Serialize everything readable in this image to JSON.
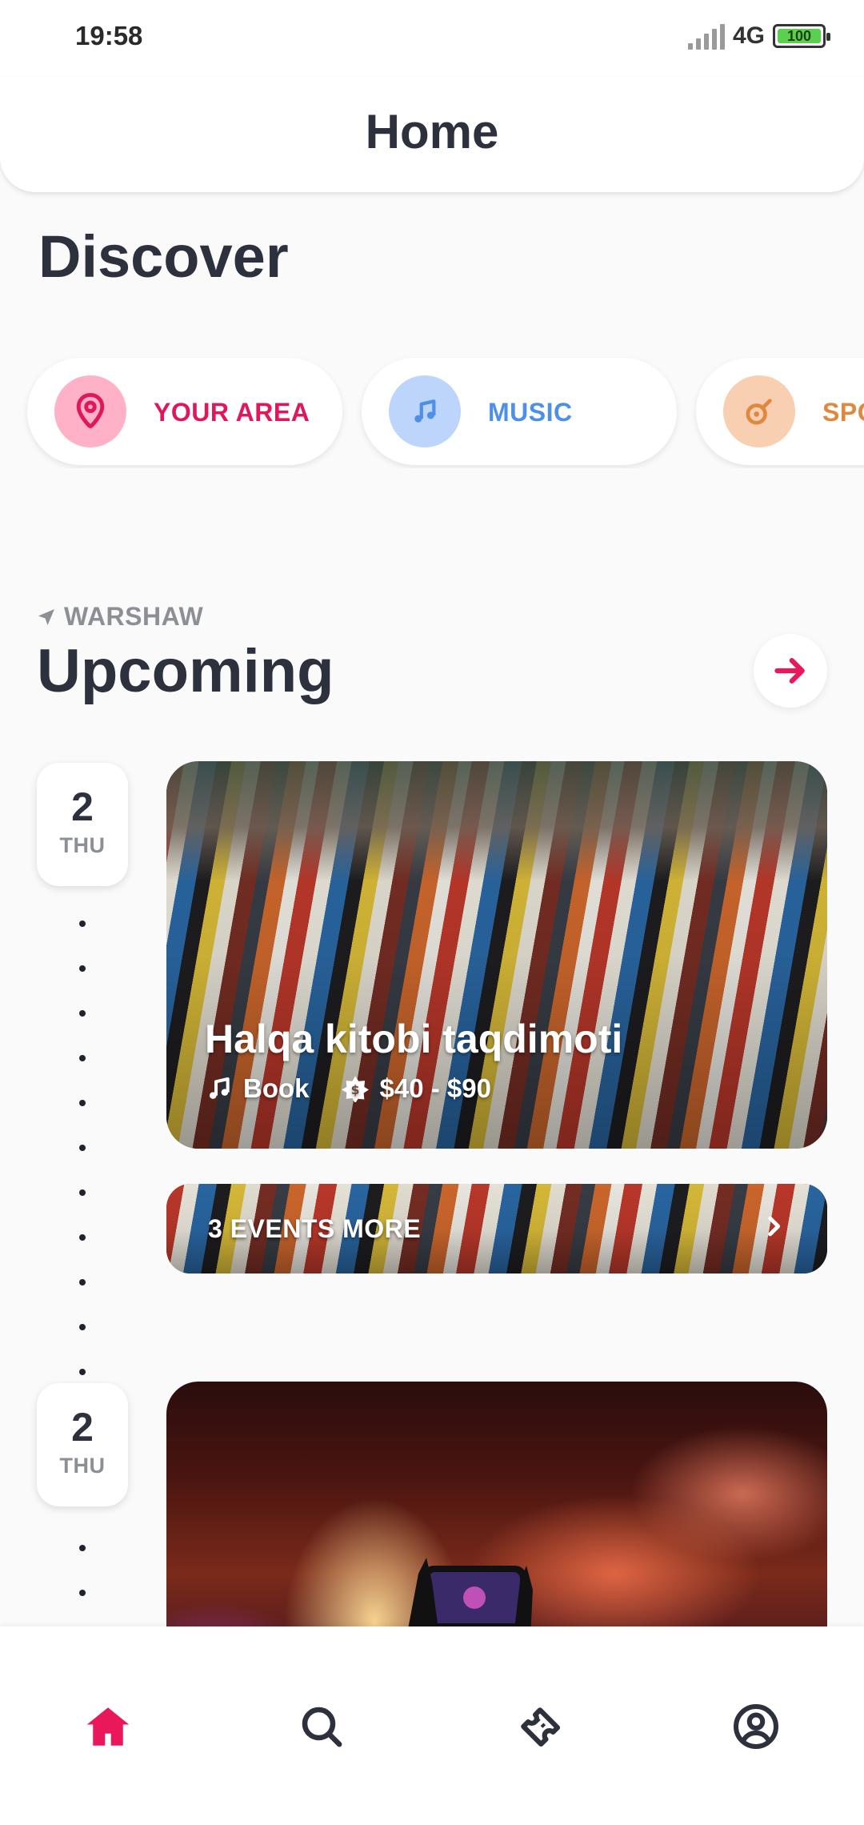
{
  "status_bar": {
    "time": "19:58",
    "network": "4G",
    "battery": "100"
  },
  "header": {
    "title": "Home"
  },
  "discover": {
    "title": "Discover"
  },
  "categories": [
    {
      "label": "YOUR AREA",
      "icon": "location-pin-icon",
      "color": "#e0185a",
      "bg": "#ffb1c8"
    },
    {
      "label": "MUSIC",
      "icon": "music-note-icon",
      "color": "#4e8fe8",
      "bg": "#bdd5fb"
    },
    {
      "label": "SPORTS",
      "icon": "sport-icon",
      "color": "#e0893e",
      "bg": "#f8cfb1"
    }
  ],
  "upcoming": {
    "location": "WARSHAW",
    "title": "Upcoming",
    "accent": "#e8185a",
    "groups": [
      {
        "date": {
          "day_number": "2",
          "weekday": "THU"
        },
        "event": {
          "title": "Halqa kitobi taqdimoti",
          "category": "Book",
          "price": "$40 - $90"
        },
        "more_label": "3 EVENTS MORE"
      },
      {
        "date": {
          "day_number": "2",
          "weekday": "THU"
        }
      }
    ]
  },
  "bottom_nav": [
    {
      "icon": "home-icon",
      "active": true
    },
    {
      "icon": "search-icon",
      "active": false
    },
    {
      "icon": "ticket-icon",
      "active": false
    },
    {
      "icon": "profile-icon",
      "active": false
    }
  ]
}
